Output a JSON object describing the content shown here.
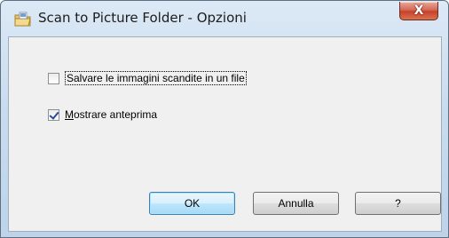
{
  "window": {
    "title": "Scan to Picture Folder - Opzioni",
    "close_glyph": "X",
    "icon": "folder-icon"
  },
  "options": [
    {
      "label": "Salvare le immagini scandite in un file",
      "checked": false
    },
    {
      "label_mnemonic": "M",
      "label_rest": "ostrare anteprima",
      "checked": true
    }
  ],
  "buttons": {
    "ok": "OK",
    "cancel": "Annulla",
    "help": "?"
  }
}
